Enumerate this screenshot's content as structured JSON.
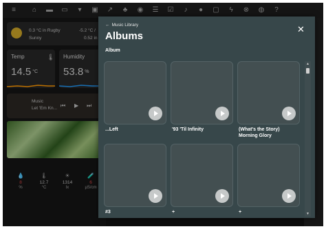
{
  "toolbar": {
    "icons": [
      "menu-icon",
      "home-icon",
      "bed-icon",
      "sofa-icon",
      "trash-icon",
      "tv-icon",
      "chart-icon",
      "plant-icon",
      "lightbulb-icon",
      "list-icon",
      "checkbox-icon",
      "music-icon",
      "spotify-icon",
      "monitor-icon",
      "bolt-icon",
      "xbox-icon",
      "soccer-icon",
      "help-icon"
    ]
  },
  "weather": {
    "line1": "0.3 °C in Rugby",
    "line1_right": "-5.2 °C / ",
    "line2": "Sunny",
    "line2_right": "0.52 in"
  },
  "temp_card": {
    "label": "Temp",
    "value": "14.5",
    "unit": "°C"
  },
  "humidity_card": {
    "label": "Humidity",
    "value": "53.8",
    "unit": "%"
  },
  "media": {
    "title": "Music",
    "subtitle": "Let 'Em Kn...",
    "prev": "⏮",
    "play": "▶",
    "next": "⏭"
  },
  "sensors": [
    {
      "icon": "💧",
      "value": "8",
      "unit": "%"
    },
    {
      "icon": "🌡",
      "value": "12.7",
      "unit": "°C"
    },
    {
      "icon": "☀",
      "value": "1314",
      "unit": "lx"
    },
    {
      "icon": "🧪",
      "value": "6",
      "unit": "µS/cm"
    }
  ],
  "panel": {
    "back_label": "Music Library",
    "title": "Albums",
    "section": "Album",
    "albums": [
      {
        "name": "...Left"
      },
      {
        "name": "'93 'Til Infinity"
      },
      {
        "name": "(What's the Story) Morning Glory"
      },
      {
        "name": "#3"
      },
      {
        "name": "+"
      },
      {
        "name": "+"
      }
    ]
  },
  "colors": {
    "panel_bg": "#37474a",
    "tile_bg": "#434f51",
    "play_button": "#c6c9c9",
    "accent_sun": "#c9a227",
    "sensor_red": "#d04444"
  }
}
